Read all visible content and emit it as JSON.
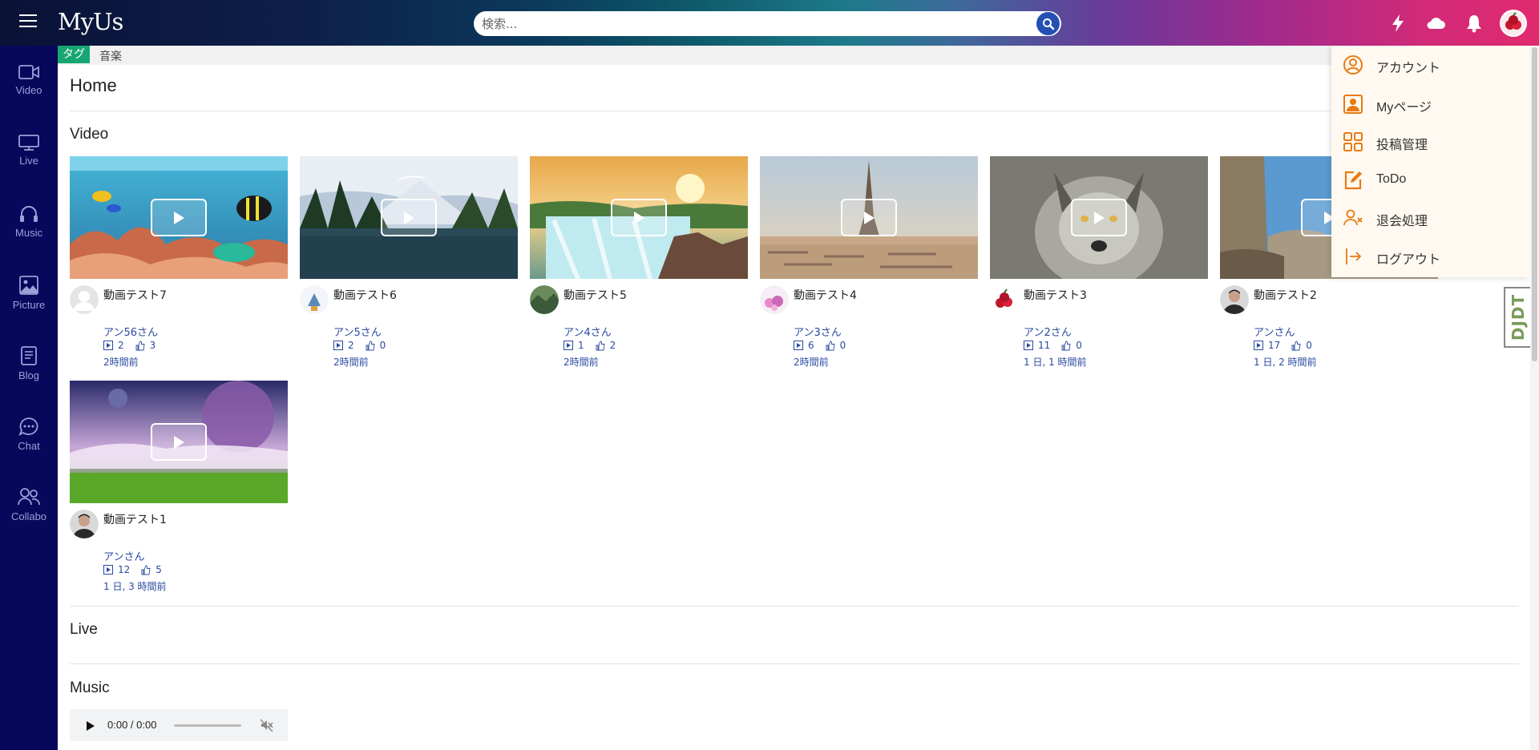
{
  "header": {
    "logo": "MyUs",
    "search_placeholder": "検索..."
  },
  "sidebar": {
    "items": [
      {
        "label": "Video",
        "icon": "video-icon"
      },
      {
        "label": "Live",
        "icon": "monitor-icon"
      },
      {
        "label": "Music",
        "icon": "headphones-icon"
      },
      {
        "label": "Picture",
        "icon": "image-icon"
      },
      {
        "label": "Blog",
        "icon": "document-icon"
      },
      {
        "label": "Chat",
        "icon": "chat-icon"
      },
      {
        "label": "Collabo",
        "icon": "users-icon"
      }
    ]
  },
  "tagbar": {
    "label": "タグ",
    "tag": "音楽"
  },
  "main": {
    "title": "Home",
    "sections": {
      "video": "Video",
      "live": "Live",
      "music": "Music"
    }
  },
  "videos": [
    {
      "title": "動画テスト7",
      "user": "アン56さん",
      "plays": "2",
      "likes": "3",
      "time": "2時間前"
    },
    {
      "title": "動画テスト6",
      "user": "アン5さん",
      "plays": "2",
      "likes": "0",
      "time": "2時間前"
    },
    {
      "title": "動画テスト5",
      "user": "アン4さん",
      "plays": "1",
      "likes": "2",
      "time": "2時間前"
    },
    {
      "title": "動画テスト4",
      "user": "アン3さん",
      "plays": "6",
      "likes": "0",
      "time": "2時間前"
    },
    {
      "title": "動画テスト3",
      "user": "アン2さん",
      "plays": "11",
      "likes": "0",
      "time": "1 日, 1 時間前"
    },
    {
      "title": "動画テスト2",
      "user": "アンさん",
      "plays": "17",
      "likes": "0",
      "time": "1 日, 2 時間前"
    },
    {
      "title": "動画テスト1",
      "user": "アンさん",
      "plays": "12",
      "likes": "5",
      "time": "1 日, 3 時間前"
    }
  ],
  "audio": {
    "time": "0:00 / 0:00"
  },
  "dropdown": {
    "items": [
      {
        "label": "アカウント",
        "icon": "account-circle-icon"
      },
      {
        "label": "Myページ",
        "icon": "profile-icon"
      },
      {
        "label": "投稿管理",
        "icon": "grid-icon"
      },
      {
        "label": "ToDo",
        "icon": "edit-icon"
      },
      {
        "label": "退会処理",
        "icon": "user-remove-icon"
      },
      {
        "label": "ログアウト",
        "icon": "logout-icon"
      }
    ]
  },
  "debug_toolbar": "DJDT",
  "colors": {
    "sidebar": "#07085b",
    "tag": "#17a673",
    "accent": "#e87a12",
    "link": "#2a4aa0"
  }
}
